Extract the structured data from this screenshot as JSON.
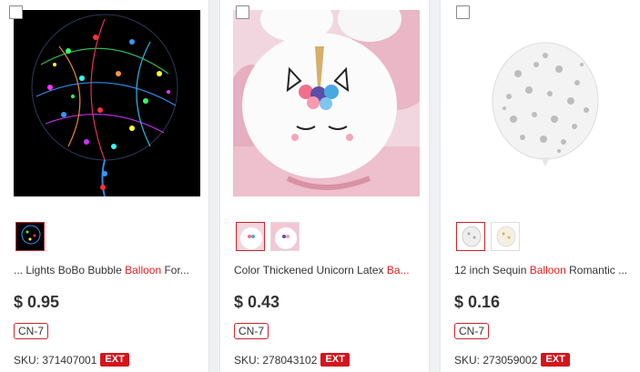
{
  "products": [
    {
      "title_pre": "... Lights BoBo Bubble ",
      "title_kw": "Balloon",
      "title_post": " For...",
      "price": "$ 0.95",
      "warehouse": "CN-7",
      "sku_label": "SKU: 371407001",
      "ext_label": "EXT",
      "image": "led-bubble-balloon-image"
    },
    {
      "title_pre": "Color Thickened Unicorn Latex ",
      "title_kw": "Ba...",
      "title_post": "",
      "price": "$ 0.43",
      "warehouse": "CN-7",
      "sku_label": "SKU: 278043102",
      "ext_label": "EXT",
      "image": "unicorn-balloon-image"
    },
    {
      "title_pre": "12 inch Sequin ",
      "title_kw": "Balloon",
      "title_post": " Romantic ...",
      "price": "$ 0.16",
      "warehouse": "CN-7",
      "sku_label": "SKU: 273059002",
      "ext_label": "EXT",
      "image": "sequin-balloon-image"
    }
  ],
  "colors": {
    "accent": "#c9252c",
    "keyword": "#e02020",
    "ext_bg": "#d4141c"
  }
}
